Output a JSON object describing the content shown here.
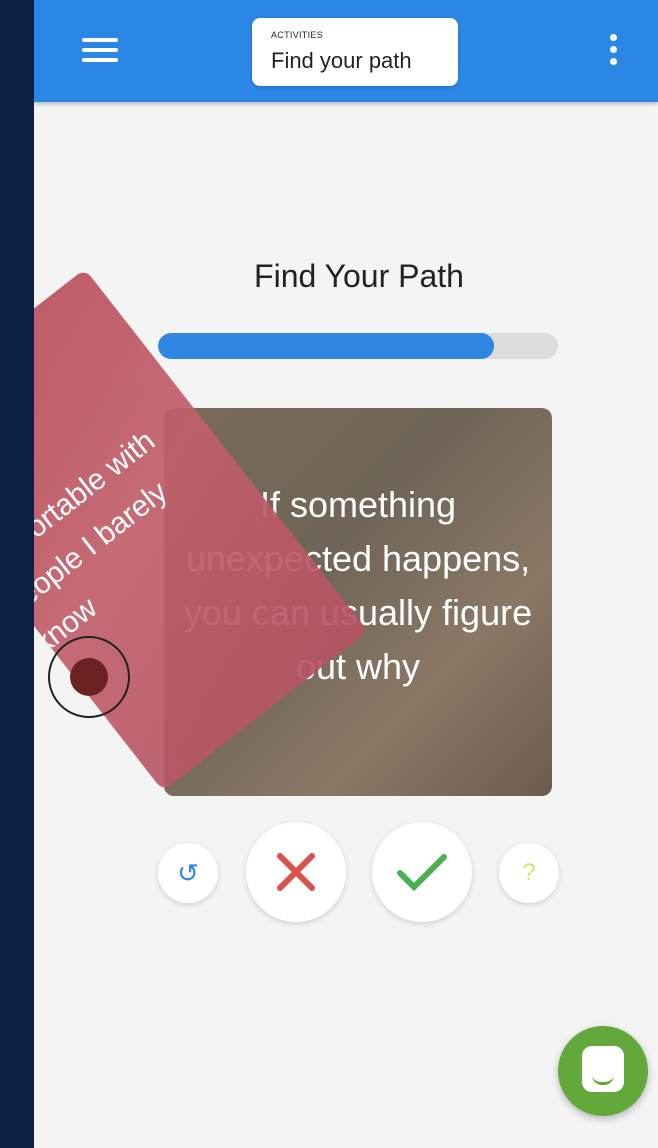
{
  "topbar": {
    "chip_small": "ACTIVITIES",
    "chip_title": "Find your path",
    "background": "#2b86e6"
  },
  "main": {
    "heading": "Find Your Path",
    "progress": 0.84,
    "card_text": "If something unexpected happens, you can usually figure out why",
    "side_card_text": "comfortable with people I barely know"
  },
  "controls": {
    "undo_icon": "undo-icon",
    "reject_icon": "close-icon",
    "accept_icon": "check-icon",
    "help_icon": "?"
  },
  "colors": {
    "accent": "#2f86e3",
    "reject": "#d9534f",
    "accept": "#4caf50",
    "chat": "#63a83a"
  }
}
